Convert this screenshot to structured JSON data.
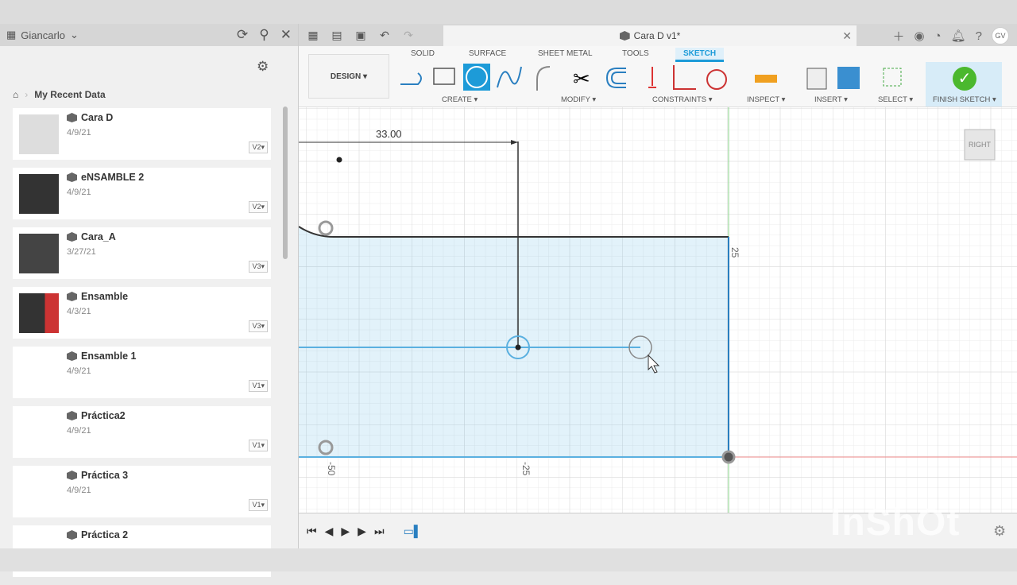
{
  "sidebar": {
    "user": "Giancarlo",
    "breadcrumb": "My Recent Data",
    "items": [
      {
        "name": "Cara D",
        "date": "4/9/21",
        "version": "V2"
      },
      {
        "name": "eNSAMBLE 2",
        "date": "4/9/21",
        "version": "V2"
      },
      {
        "name": "Cara_A",
        "date": "3/27/21",
        "version": "V3"
      },
      {
        "name": "Ensamble",
        "date": "4/3/21",
        "version": "V3"
      },
      {
        "name": "Ensamble 1",
        "date": "4/9/21",
        "version": "V1"
      },
      {
        "name": "Práctica2",
        "date": "4/9/21",
        "version": "V1"
      },
      {
        "name": "Práctica 3",
        "date": "4/9/21",
        "version": "V1"
      },
      {
        "name": "Práctica 2",
        "date": "",
        "version": ""
      }
    ]
  },
  "app": {
    "doc_title": "Cara D v1*",
    "avatar": "GV",
    "workspace": "DESIGN ▾",
    "tabs": [
      "SOLID",
      "SURFACE",
      "SHEET METAL",
      "TOOLS",
      "SKETCH"
    ],
    "active_tab": "SKETCH",
    "groups": [
      "CREATE ▾",
      "MODIFY ▾",
      "CONSTRAINTS ▾",
      "INSPECT ▾",
      "INSERT ▾",
      "SELECT ▾",
      "FINISH SKETCH ▾"
    ]
  },
  "canvas": {
    "dimension": "33.00",
    "ticks": [
      "-50",
      "-25",
      "25"
    ],
    "viewcube": "RIGHT",
    "accent": "#1d9bd8",
    "sketch_fill": "#e3f1fb"
  },
  "watermark": "InShOt"
}
